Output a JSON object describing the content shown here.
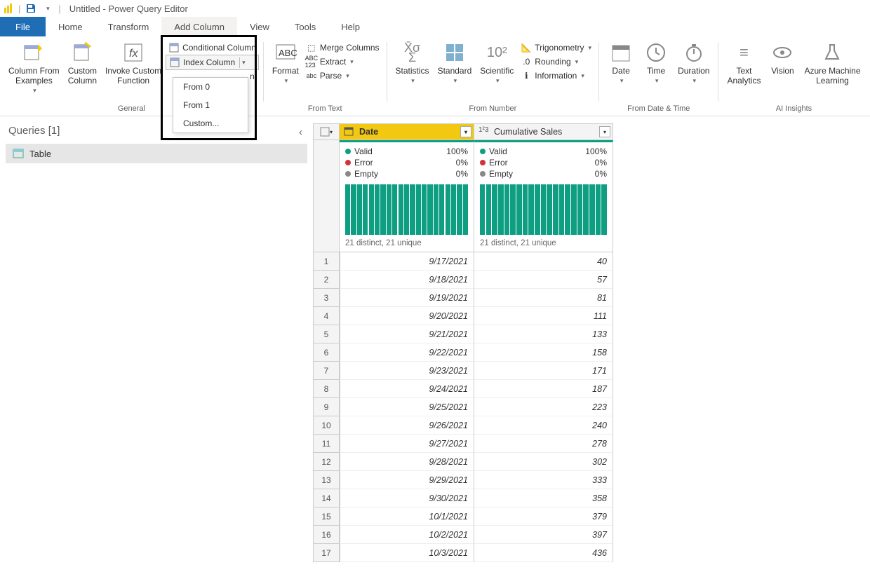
{
  "title": "Untitled - Power Query Editor",
  "tabs": {
    "file": "File",
    "home": "Home",
    "transform": "Transform",
    "addcolumn": "Add Column",
    "view": "View",
    "tools": "Tools",
    "help": "Help"
  },
  "ribbon": {
    "general": {
      "col_from_examples": "Column From\nExamples",
      "custom_column": "Custom\nColumn",
      "invoke_custom_fn": "Invoke Custom\nFunction",
      "conditional_column": "Conditional Column",
      "index_column": "Index Column",
      "duplicate_column_suffix": "n",
      "label": "General"
    },
    "index_dropdown": {
      "from0": "From 0",
      "from1": "From 1",
      "custom": "Custom..."
    },
    "fromtext": {
      "format": "Format",
      "merge": "Merge Columns",
      "extract": "Extract",
      "parse": "Parse",
      "label": "From Text"
    },
    "fromnumber": {
      "statistics": "Statistics",
      "standard": "Standard",
      "scientific": "Scientific",
      "trig": "Trigonometry",
      "rounding": "Rounding",
      "information": "Information",
      "label": "From Number"
    },
    "fromdatetime": {
      "date": "Date",
      "time": "Time",
      "duration": "Duration",
      "label": "From Date & Time"
    },
    "ai": {
      "text": "Text\nAnalytics",
      "vision": "Vision",
      "aml": "Azure Machine\nLearning",
      "label": "AI Insights"
    }
  },
  "queries": {
    "header": "Queries [1]",
    "item": "Table"
  },
  "columns": {
    "date": {
      "name": "Date",
      "valid": "Valid",
      "valid_pct": "100%",
      "error": "Error",
      "error_pct": "0%",
      "empty": "Empty",
      "empty_pct": "0%",
      "distinct": "21 distinct, 21 unique"
    },
    "sales": {
      "name": "Cumulative Sales",
      "valid": "Valid",
      "valid_pct": "100%",
      "error": "Error",
      "error_pct": "0%",
      "empty": "Empty",
      "empty_pct": "0%",
      "distinct": "21 distinct, 21 unique"
    }
  },
  "rows": [
    {
      "n": "1",
      "date": "9/17/2021",
      "sales": "40"
    },
    {
      "n": "2",
      "date": "9/18/2021",
      "sales": "57"
    },
    {
      "n": "3",
      "date": "9/19/2021",
      "sales": "81"
    },
    {
      "n": "4",
      "date": "9/20/2021",
      "sales": "111"
    },
    {
      "n": "5",
      "date": "9/21/2021",
      "sales": "133"
    },
    {
      "n": "6",
      "date": "9/22/2021",
      "sales": "158"
    },
    {
      "n": "7",
      "date": "9/23/2021",
      "sales": "171"
    },
    {
      "n": "8",
      "date": "9/24/2021",
      "sales": "187"
    },
    {
      "n": "9",
      "date": "9/25/2021",
      "sales": "223"
    },
    {
      "n": "10",
      "date": "9/26/2021",
      "sales": "240"
    },
    {
      "n": "11",
      "date": "9/27/2021",
      "sales": "278"
    },
    {
      "n": "12",
      "date": "9/28/2021",
      "sales": "302"
    },
    {
      "n": "13",
      "date": "9/29/2021",
      "sales": "333"
    },
    {
      "n": "14",
      "date": "9/30/2021",
      "sales": "358"
    },
    {
      "n": "15",
      "date": "10/1/2021",
      "sales": "379"
    },
    {
      "n": "16",
      "date": "10/2/2021",
      "sales": "397"
    },
    {
      "n": "17",
      "date": "10/3/2021",
      "sales": "436"
    }
  ]
}
